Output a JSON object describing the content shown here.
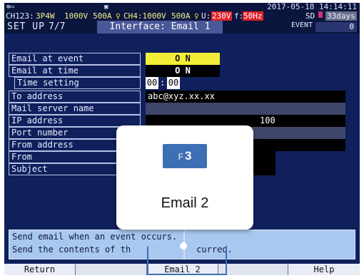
{
  "status": {
    "datetime": "2017-05-18 14:14:11",
    "ch123": "CH123:",
    "wiring": "3P4W",
    "voltage_range": "1000V",
    "current_range1": "500A",
    "ch4": "CH4:1000V",
    "current_range2": "500A",
    "u_label": "U:",
    "u_value": "230V",
    "f_label": "f:",
    "f_value": "50Hz",
    "sd_label": "SD",
    "sd_days": "33days"
  },
  "header": {
    "setup": "SET UP",
    "page": "7/7",
    "title": "Interface: Email 1",
    "event_label": "EVENT",
    "event_count": "0"
  },
  "settings": {
    "email_at_event": {
      "label": "Email at event",
      "value": "O N"
    },
    "email_at_time": {
      "label": "Email at time",
      "value": "O N"
    },
    "time_setting": {
      "label": "Time setting",
      "hour": "00",
      "sep": ":",
      "minute": "00"
    },
    "to_address": {
      "label": "To address",
      "value": "abc@xyz.xx.xx"
    },
    "mail_server_name": {
      "label": "Mail server name",
      "value": ""
    },
    "ip_address": {
      "label": "IP address",
      "value": "100"
    },
    "port_number": {
      "label": "Port number",
      "value": ""
    },
    "from_address": {
      "label": "From address",
      "value": ""
    },
    "from": {
      "label": "From",
      "value": ""
    },
    "subject": {
      "label": "Subject",
      "value": ""
    }
  },
  "description": {
    "line1": "Send email when an event occurs.",
    "line2": "Send the contents of th",
    "line2_tail": "curred."
  },
  "fkeys": {
    "f1": "Return",
    "f2": "",
    "f3": "Email 2",
    "f4": "",
    "f5": "Help"
  },
  "popup": {
    "key_prefix": "F",
    "key_number": "3",
    "caption": "Email 2"
  },
  "colors": {
    "screen_bg": "#10205c",
    "on_yellow": "#f2ee38",
    "accent_blue": "#3d6fb4",
    "desc_bg": "#a9c8ef"
  }
}
